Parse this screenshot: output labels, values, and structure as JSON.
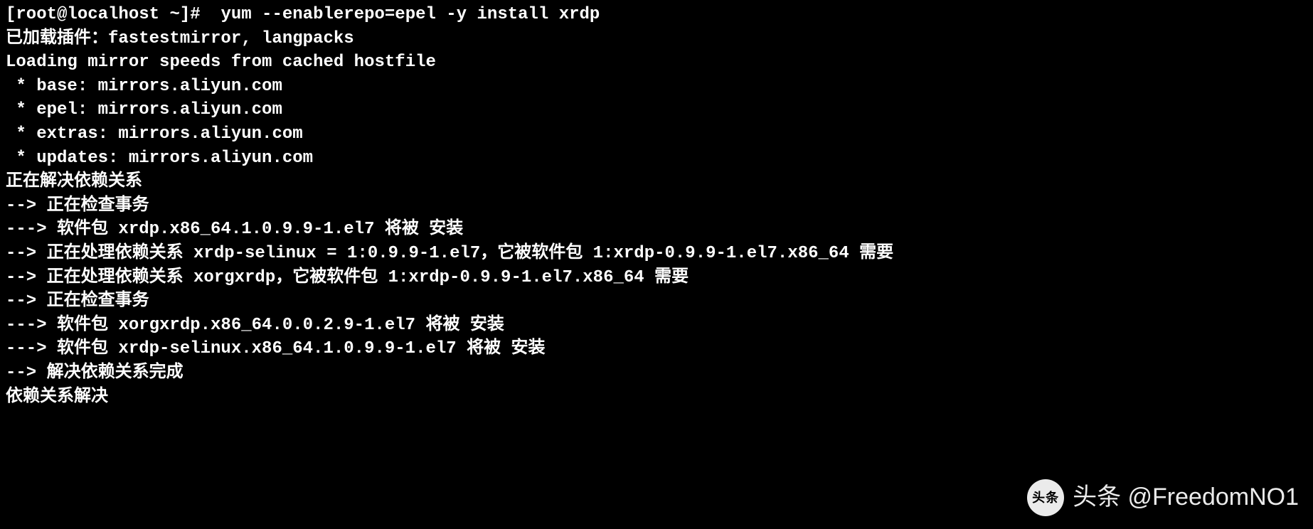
{
  "terminal": {
    "lines": [
      "[root@localhost ~]#  yum --enablerepo=epel -y install xrdp",
      "已加载插件：fastestmirror, langpacks",
      "Loading mirror speeds from cached hostfile",
      " * base: mirrors.aliyun.com",
      " * epel: mirrors.aliyun.com",
      " * extras: mirrors.aliyun.com",
      " * updates: mirrors.aliyun.com",
      "正在解决依赖关系",
      "--> 正在检查事务",
      "---> 软件包 xrdp.x86_64.1.0.9.9-1.el7 将被 安装",
      "--> 正在处理依赖关系 xrdp-selinux = 1:0.9.9-1.el7，它被软件包 1:xrdp-0.9.9-1.el7.x86_64 需要",
      "--> 正在处理依赖关系 xorgxrdp，它被软件包 1:xrdp-0.9.9-1.el7.x86_64 需要",
      "--> 正在检查事务",
      "---> 软件包 xorgxrdp.x86_64.0.0.2.9-1.el7 将被 安装",
      "---> 软件包 xrdp-selinux.x86_64.1.0.9.9-1.el7 将被 安装",
      "--> 解决依赖关系完成",
      "",
      "依赖关系解决"
    ]
  },
  "watermark": {
    "logo_text": "头条",
    "text": "头条 @FreedomNO1"
  }
}
